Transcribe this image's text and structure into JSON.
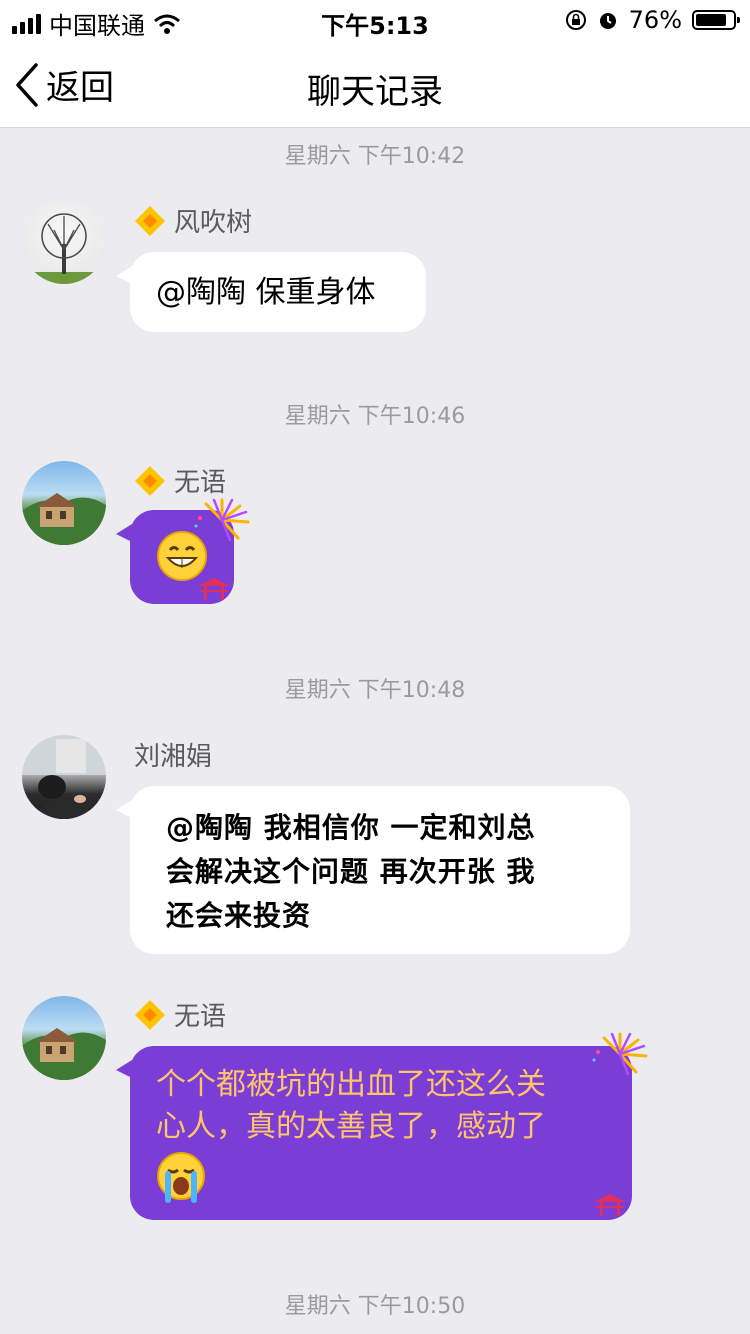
{
  "status_bar": {
    "carrier": "中国联通",
    "time": "下午5:13",
    "battery_percent": "76%",
    "battery_level": 0.76
  },
  "nav": {
    "back_label": "返回",
    "title": "聊天记录"
  },
  "timestamps": [
    "星期六 下午10:42",
    "星期六 下午10:46",
    "星期六 下午10:48",
    "星期六 下午10:50"
  ],
  "messages": [
    {
      "sender": "风吹树",
      "text": "@陶陶 保重身体",
      "avatar": "tree-avatar"
    },
    {
      "sender": "无语",
      "text": "",
      "emoji": "grinning-emoji",
      "avatar": "house-avatar"
    },
    {
      "sender": "刘湘娟",
      "lines": [
        "@陶陶 我相信你 一定和刘总",
        "会解决这个问题 再次开张 我",
        "还会来投资"
      ],
      "avatar": "person-avatar"
    },
    {
      "sender": "无语",
      "lines": [
        "个个都被坑的出血了还这么关",
        "心人，真的太善良了，感动了"
      ],
      "emoji": "crying-emoji",
      "avatar": "house-avatar"
    }
  ],
  "colors": {
    "background": "#ececf0",
    "purple_bubble": "#7a3ed6",
    "purple_text": "#ffc36a",
    "timestamp": "#9b9b9f"
  }
}
